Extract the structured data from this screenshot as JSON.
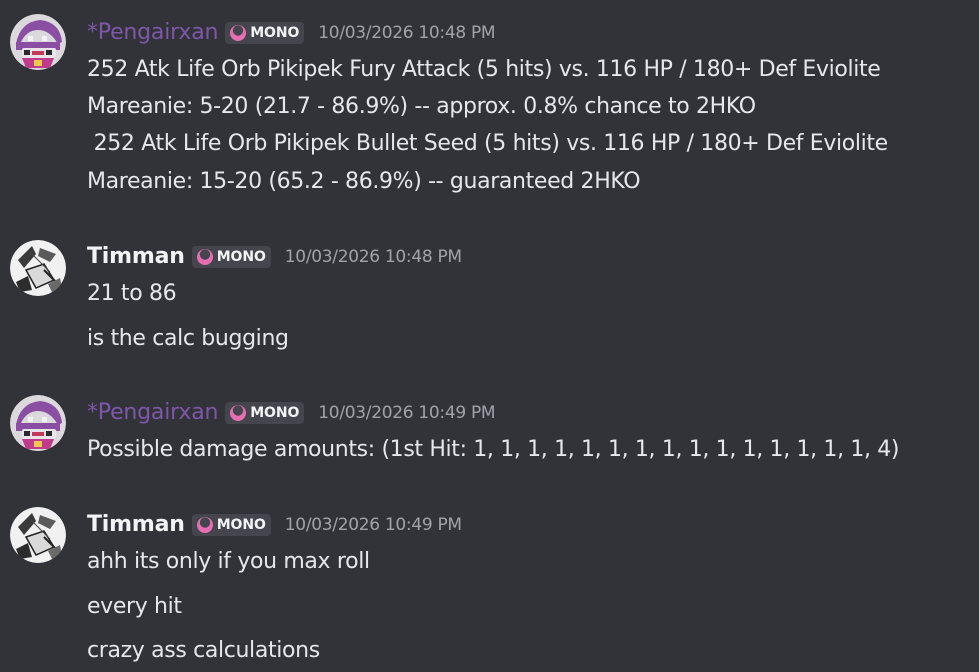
{
  "messages": [
    {
      "author": "*Pengairxan",
      "tag": "MONO",
      "timestamp": "10/03/2026 10:48 PM",
      "lines": [
        "252 Atk Life Orb Pikipek Fury Attack (5 hits) vs. 116 HP / 180+ Def Eviolite",
        "Mareanie: 5-20 (21.7 - 86.9%) -- approx. 0.8% chance to 2HKO",
        " 252 Atk Life Orb Pikipek Bullet Seed (5 hits) vs. 116 HP / 180+ Def Eviolite",
        "Mareanie: 15-20 (65.2 - 86.9%) -- guaranteed 2HKO"
      ]
    },
    {
      "author": "Timman",
      "tag": "MONO",
      "timestamp": "10/03/2026 10:48 PM",
      "lines": [
        "21 to 86",
        "is the calc bugging"
      ]
    },
    {
      "author": "*Pengairxan",
      "tag": "MONO",
      "timestamp": "10/03/2026 10:49 PM",
      "lines": [
        "Possible damage amounts: (1st Hit: 1, 1, 1, 1, 1, 1, 1, 1, 1, 1, 1, 1, 1, 1, 1, 4)"
      ]
    },
    {
      "author": "Timman",
      "tag": "MONO",
      "timestamp": "10/03/2026 10:49 PM",
      "lines": [
        "ahh its only if you max roll",
        "every hit",
        "crazy ass calculations"
      ]
    }
  ],
  "colors": {
    "background": "#323339",
    "pengairxan_name": "#7e57a9",
    "timman_name": "#f2f3f5",
    "message_text": "#e6e7ea",
    "timestamp": "#a0a3aa",
    "tag_background": "#45464d",
    "tag_icon": "#e56fb0"
  },
  "icons": {
    "avatar_pengairxan": "pokemon-avatar-icon",
    "avatar_timman": "manga-avatar-icon",
    "tag_icon": "pink-crescent-icon"
  }
}
